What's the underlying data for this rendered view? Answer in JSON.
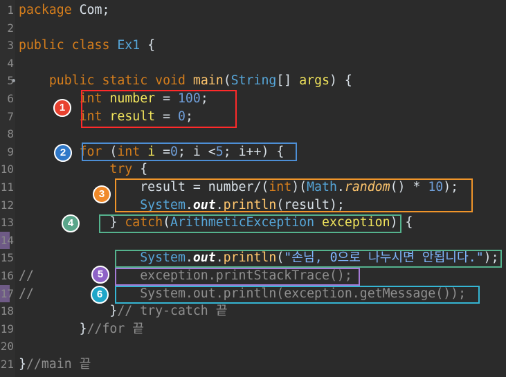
{
  "lines": [
    {
      "n": "1",
      "tokens": [
        {
          "c": "kw",
          "t": "package"
        },
        {
          "c": "punc",
          "t": " Com;"
        }
      ]
    },
    {
      "n": "2",
      "tokens": []
    },
    {
      "n": "3",
      "tokens": [
        {
          "c": "kw",
          "t": "public"
        },
        {
          "c": "punc",
          "t": " "
        },
        {
          "c": "kw",
          "t": "class"
        },
        {
          "c": "punc",
          "t": " "
        },
        {
          "c": "cls",
          "t": "Ex1"
        },
        {
          "c": "punc",
          "t": " {"
        }
      ]
    },
    {
      "n": "4",
      "tokens": []
    },
    {
      "n": "5",
      "tokens": [
        {
          "c": "punc",
          "t": "    "
        },
        {
          "c": "kw",
          "t": "public"
        },
        {
          "c": "punc",
          "t": " "
        },
        {
          "c": "kw",
          "t": "static"
        },
        {
          "c": "punc",
          "t": " "
        },
        {
          "c": "kw",
          "t": "void"
        },
        {
          "c": "punc",
          "t": " "
        },
        {
          "c": "meth",
          "t": "main"
        },
        {
          "c": "punc",
          "t": "("
        },
        {
          "c": "cls",
          "t": "String"
        },
        {
          "c": "punc",
          "t": "[] "
        },
        {
          "c": "var",
          "t": "args"
        },
        {
          "c": "punc",
          "t": ") {"
        }
      ]
    },
    {
      "n": "6",
      "tokens": [
        {
          "c": "punc",
          "t": "        "
        },
        {
          "c": "typ",
          "t": "int"
        },
        {
          "c": "punc",
          "t": " "
        },
        {
          "c": "var",
          "t": "number"
        },
        {
          "c": "punc",
          "t": " = "
        },
        {
          "c": "num",
          "t": "100"
        },
        {
          "c": "punc",
          "t": ";"
        }
      ]
    },
    {
      "n": "7",
      "tokens": [
        {
          "c": "punc",
          "t": "        "
        },
        {
          "c": "typ",
          "t": "int"
        },
        {
          "c": "punc",
          "t": " "
        },
        {
          "c": "var",
          "t": "result"
        },
        {
          "c": "punc",
          "t": " = "
        },
        {
          "c": "num",
          "t": "0"
        },
        {
          "c": "punc",
          "t": ";"
        }
      ]
    },
    {
      "n": "8",
      "tokens": []
    },
    {
      "n": "9",
      "tokens": [
        {
          "c": "punc",
          "t": "        "
        },
        {
          "c": "kw",
          "t": "for"
        },
        {
          "c": "punc",
          "t": " ("
        },
        {
          "c": "typ",
          "t": "int"
        },
        {
          "c": "punc",
          "t": " "
        },
        {
          "c": "var",
          "t": "i"
        },
        {
          "c": "punc",
          "t": " ="
        },
        {
          "c": "num",
          "t": "0"
        },
        {
          "c": "punc",
          "t": "; i <"
        },
        {
          "c": "num",
          "t": "5"
        },
        {
          "c": "punc",
          "t": "; i++) {"
        }
      ]
    },
    {
      "n": "10",
      "tokens": [
        {
          "c": "punc",
          "t": "            "
        },
        {
          "c": "kw",
          "t": "try"
        },
        {
          "c": "punc",
          "t": " {"
        }
      ]
    },
    {
      "n": "11",
      "tokens": [
        {
          "c": "punc",
          "t": "                result = number/("
        },
        {
          "c": "typ",
          "t": "int"
        },
        {
          "c": "punc",
          "t": ")("
        },
        {
          "c": "cls",
          "t": "Math"
        },
        {
          "c": "punc",
          "t": "."
        },
        {
          "c": "static-m",
          "t": "random"
        },
        {
          "c": "punc",
          "t": "() * "
        },
        {
          "c": "num",
          "t": "10"
        },
        {
          "c": "punc",
          "t": ");"
        }
      ]
    },
    {
      "n": "12",
      "tokens": [
        {
          "c": "punc",
          "t": "                "
        },
        {
          "c": "cls",
          "t": "System"
        },
        {
          "c": "punc",
          "t": "."
        },
        {
          "c": "field",
          "t": "out"
        },
        {
          "c": "punc",
          "t": "."
        },
        {
          "c": "meth",
          "t": "println"
        },
        {
          "c": "punc",
          "t": "(result);"
        }
      ]
    },
    {
      "n": "13",
      "tokens": [
        {
          "c": "punc",
          "t": "            } "
        },
        {
          "c": "kw",
          "t": "catch"
        },
        {
          "c": "punc",
          "t": "("
        },
        {
          "c": "cls",
          "t": "ArithmeticException"
        },
        {
          "c": "punc",
          "t": " "
        },
        {
          "c": "var",
          "t": "exception"
        },
        {
          "c": "punc",
          "t": ") {"
        }
      ]
    },
    {
      "n": "14",
      "tokens": []
    },
    {
      "n": "15",
      "tokens": [
        {
          "c": "punc",
          "t": "                "
        },
        {
          "c": "cls",
          "t": "System"
        },
        {
          "c": "punc",
          "t": "."
        },
        {
          "c": "field",
          "t": "out"
        },
        {
          "c": "punc",
          "t": "."
        },
        {
          "c": "meth",
          "t": "println"
        },
        {
          "c": "punc",
          "t": "("
        },
        {
          "c": "str",
          "t": "\"손님, 0으로 나누시면 안됩니다.\""
        },
        {
          "c": "punc",
          "t": ");"
        }
      ]
    },
    {
      "n": "16",
      "tokens": [
        {
          "c": "cmt",
          "t": "//              exception.printStackTrace();"
        }
      ]
    },
    {
      "n": "17",
      "tokens": [
        {
          "c": "cmt",
          "t": "//              System.out.println(exception.getMessage());"
        }
      ]
    },
    {
      "n": "18",
      "tokens": [
        {
          "c": "punc",
          "t": "            }"
        },
        {
          "c": "cmt",
          "t": "// try-catch 끝"
        }
      ]
    },
    {
      "n": "19",
      "tokens": [
        {
          "c": "punc",
          "t": "        }"
        },
        {
          "c": "cmt",
          "t": "//for 끝"
        }
      ]
    },
    {
      "n": "20",
      "tokens": []
    },
    {
      "n": "21",
      "tokens": [
        {
          "c": "punc",
          "t": "}"
        },
        {
          "c": "cmt",
          "t": "//main 끝"
        }
      ]
    }
  ],
  "annotations": [
    {
      "label": "1",
      "color": "#e8412f",
      "border": "#ff2a2a"
    },
    {
      "label": "2",
      "color": "#2f78c8",
      "border": "#4d8fd6"
    },
    {
      "label": "3",
      "color": "#f08a2a",
      "border": "#f0952a"
    },
    {
      "label": "4",
      "color": "#5aa58a",
      "border": "#55b38e"
    },
    {
      "label": "5",
      "color": "#8e62c6",
      "border": "#a57ad6"
    },
    {
      "label": "6",
      "color": "#1fa6c8",
      "border": "#35b6d4"
    }
  ]
}
